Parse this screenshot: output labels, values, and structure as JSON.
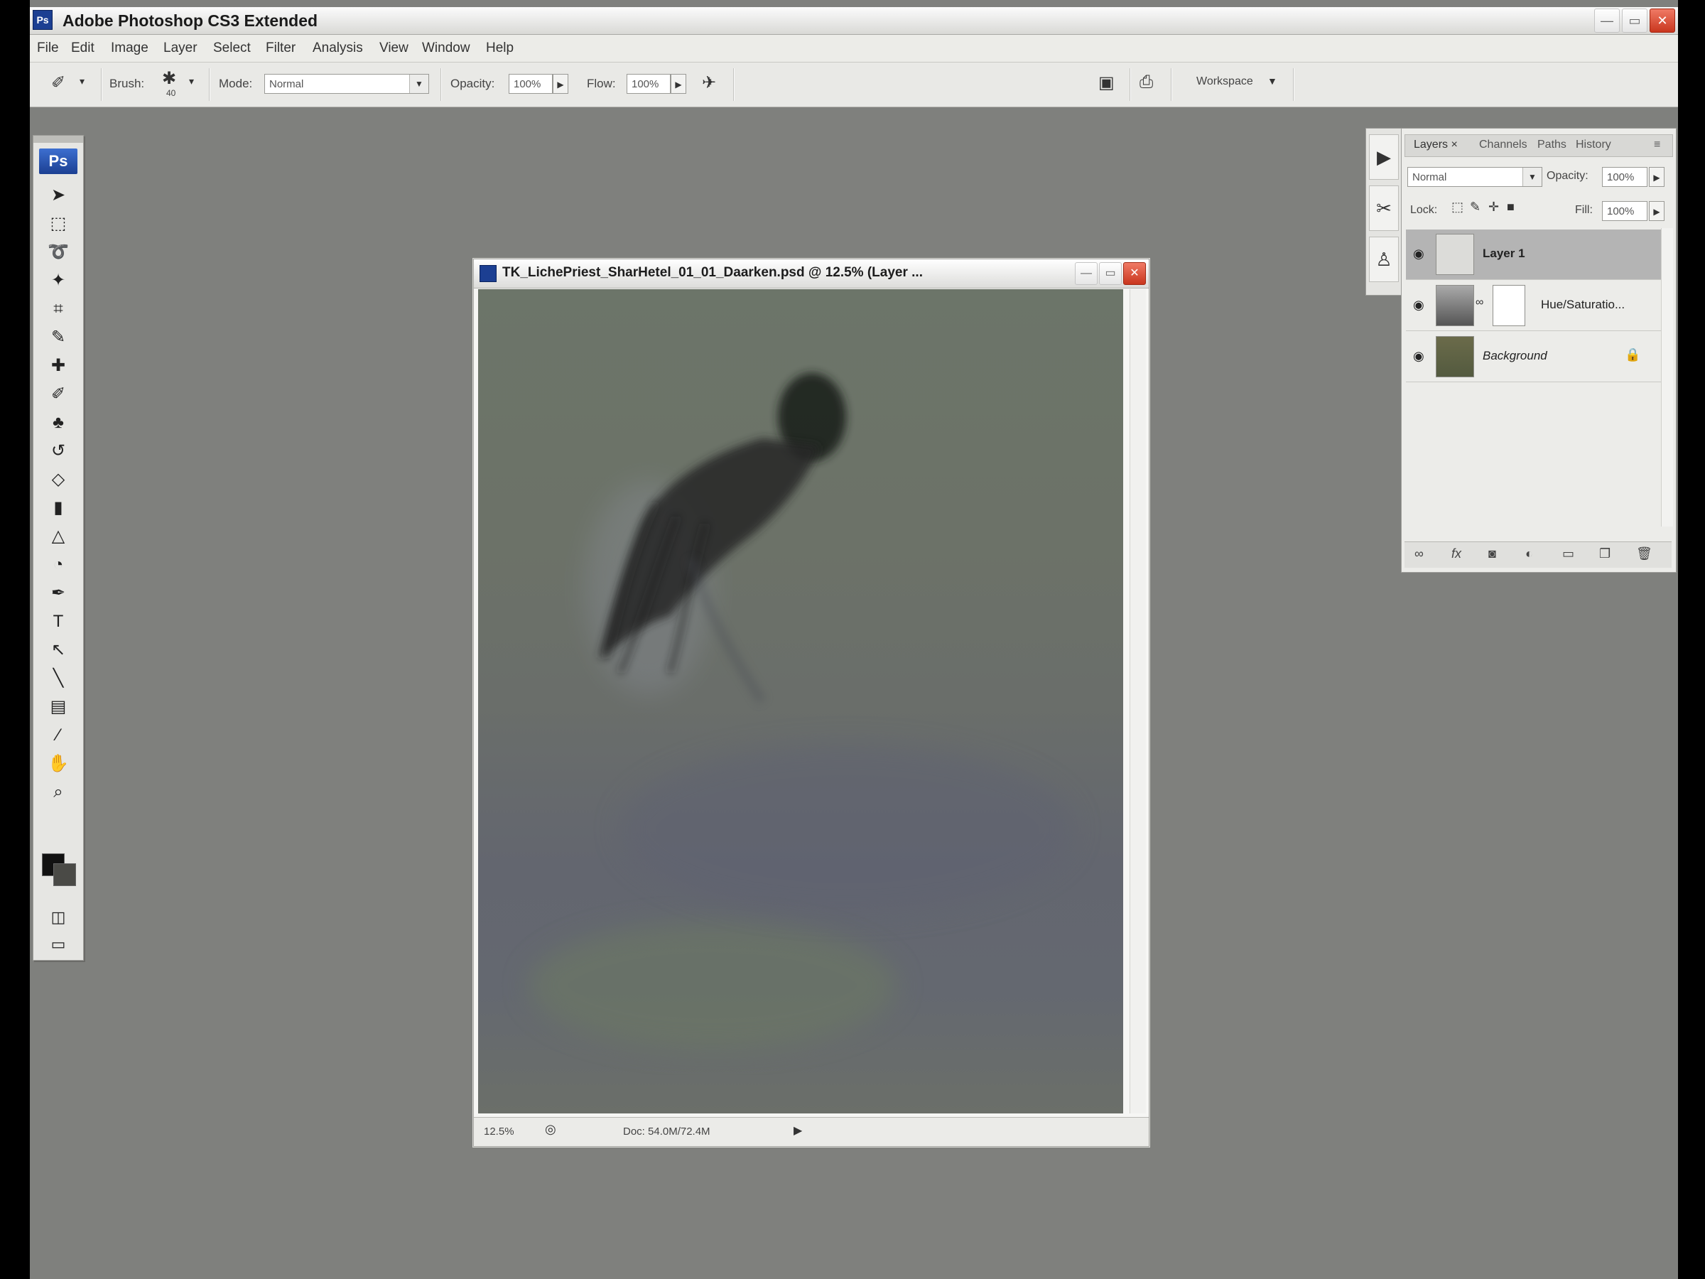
{
  "app": {
    "title": "Adobe Photoshop CS3 Extended",
    "title_icon": "Ps"
  },
  "window_controls": {
    "minimize": "—",
    "restore": "▭",
    "close": "✕"
  },
  "menu": [
    "File",
    "Edit",
    "Image",
    "Layer",
    "Select",
    "Filter",
    "Analysis",
    "View",
    "Window",
    "Help"
  ],
  "options_bar": {
    "brush_label": "Brush:",
    "brush_size": "40",
    "mode_label": "Mode:",
    "mode_value": "Normal",
    "opacity_label": "Opacity:",
    "opacity_value": "100%",
    "flow_label": "Flow:",
    "flow_value": "100%",
    "workspace_label": "Workspace"
  },
  "toolbox": {
    "badge": "Ps",
    "tools": [
      {
        "name": "move-tool-icon",
        "glyph": "➤"
      },
      {
        "name": "marquee-tool-icon",
        "glyph": "⬚"
      },
      {
        "name": "lasso-tool-icon",
        "glyph": "➰"
      },
      {
        "name": "magic-wand-tool-icon",
        "glyph": "✦"
      },
      {
        "name": "crop-tool-icon",
        "glyph": "⌗"
      },
      {
        "name": "slice-tool-icon",
        "glyph": "✎"
      },
      {
        "name": "healing-brush-tool-icon",
        "glyph": "✚"
      },
      {
        "name": "brush-tool-icon",
        "glyph": "✐"
      },
      {
        "name": "clone-stamp-tool-icon",
        "glyph": "♣"
      },
      {
        "name": "history-brush-tool-icon",
        "glyph": "↺"
      },
      {
        "name": "eraser-tool-icon",
        "glyph": "◇"
      },
      {
        "name": "gradient-tool-icon",
        "glyph": "▮"
      },
      {
        "name": "blur-tool-icon",
        "glyph": "△"
      },
      {
        "name": "dodge-tool-icon",
        "glyph": "◔"
      },
      {
        "name": "pen-tool-icon",
        "glyph": "✒"
      },
      {
        "name": "type-tool-icon",
        "glyph": "T"
      },
      {
        "name": "path-selection-tool-icon",
        "glyph": "↖"
      },
      {
        "name": "line-tool-icon",
        "glyph": "╲"
      },
      {
        "name": "notes-tool-icon",
        "glyph": "▤"
      },
      {
        "name": "eyedropper-tool-icon",
        "glyph": "⁄"
      },
      {
        "name": "hand-tool-icon",
        "glyph": "✋"
      },
      {
        "name": "zoom-tool-icon",
        "glyph": "⌕"
      }
    ]
  },
  "document": {
    "title": "TK_LichePriest_SharHetel_01_01_Daarken.psd @ 12.5% (Layer ...",
    "zoom": "12.5%",
    "doc_size": "Doc: 54.0M/72.4M"
  },
  "layers_panel": {
    "tabs": [
      "Layers ×",
      "Channels",
      "Paths",
      "History"
    ],
    "blend_mode": "Normal",
    "opacity_label": "Opacity:",
    "opacity_value": "100%",
    "lock_label": "Lock:",
    "fill_label": "Fill:",
    "fill_value": "100%",
    "layers": [
      {
        "name": "Layer 1",
        "selected": true
      },
      {
        "name": "Hue/Saturatio...",
        "selected": false
      },
      {
        "name": "Background",
        "selected": false
      }
    ],
    "footer_icons": [
      "link-icon",
      "fx-icon",
      "mask-icon",
      "adjustment-icon",
      "group-icon",
      "new-layer-icon",
      "trash-icon"
    ]
  },
  "colors": {
    "workspace_bg": "#7f807d",
    "foreground_swatch": "#111111",
    "background_swatch": "#4a4a46",
    "accent": "#1c3f92"
  }
}
